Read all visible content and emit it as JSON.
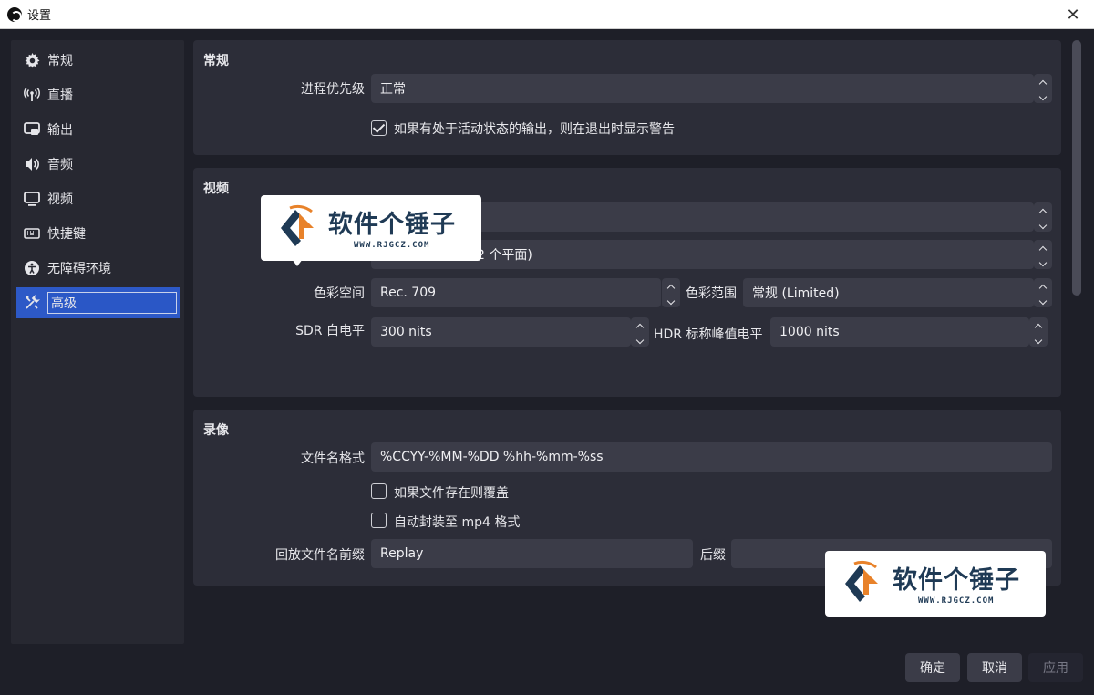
{
  "window": {
    "title": "设置"
  },
  "sidebar": {
    "items": [
      {
        "label": "常规",
        "icon": "gear-icon"
      },
      {
        "label": "直播",
        "icon": "broadcast-icon"
      },
      {
        "label": "输出",
        "icon": "output-icon"
      },
      {
        "label": "音频",
        "icon": "speaker-icon"
      },
      {
        "label": "视频",
        "icon": "monitor-icon"
      },
      {
        "label": "快捷键",
        "icon": "keyboard-icon"
      },
      {
        "label": "无障碍环境",
        "icon": "accessibility-icon"
      },
      {
        "label": "高级",
        "icon": "tools-icon",
        "active": true
      }
    ]
  },
  "general": {
    "title": "常规",
    "priority_label": "进程优先级",
    "priority_value": "正常",
    "warn_checkbox_label": "如果有处于活动状态的输出，则在退出时显示警告",
    "warn_checked": true
  },
  "video": {
    "title": "视频",
    "format_partial": "2 个平面)",
    "color_space_label": "色彩空间",
    "color_space_value": "Rec. 709",
    "color_range_label": "色彩范围",
    "color_range_value": "常规 (Limited)",
    "sdr_label": "SDR 白电平",
    "sdr_value": "300 nits",
    "hdr_label": "HDR 标称峰值电平",
    "hdr_value": "1000 nits"
  },
  "recording": {
    "title": "录像",
    "filename_label": "文件名格式",
    "filename_value": "%CCYY-%MM-%DD %hh-%mm-%ss",
    "overwrite_label": "如果文件存在则覆盖",
    "overwrite_checked": false,
    "remux_label": "自动封装至 mp4 格式",
    "remux_checked": false,
    "replay_prefix_label": "回放文件名前缀",
    "replay_prefix_value": "Replay",
    "suffix_label": "后缀",
    "suffix_value": ""
  },
  "buttons": {
    "ok": "确定",
    "cancel": "取消",
    "apply": "应用"
  },
  "watermark": {
    "text": "软件个锤子",
    "url": "WWW.RJGCZ.COM"
  },
  "colors": {
    "accent": "#2d59c7",
    "background": "#1e1f28",
    "panel": "#2c2d38",
    "field": "#3b3c48"
  }
}
